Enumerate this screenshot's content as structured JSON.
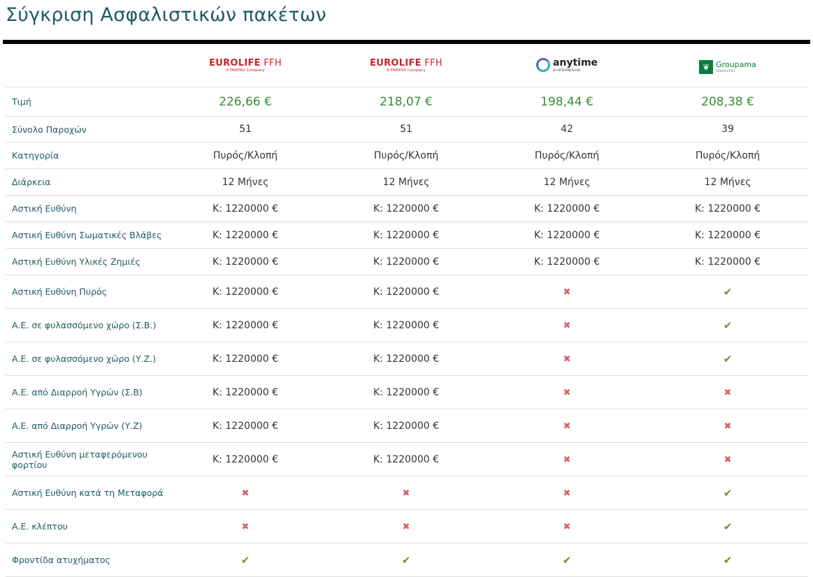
{
  "title": "Σύγκριση Ασφαλιστικών πακέτων",
  "colors": {
    "title": "#1f5b60",
    "price": "#3c8a3c",
    "yes": "#6a8f2e",
    "no": "#d86060"
  },
  "icons": {
    "yes": "checkmark-icon",
    "no": "cross-icon"
  },
  "symbols": {
    "yes": "✔",
    "no": "✖"
  },
  "providers": [
    {
      "name": "EUROLIFE FFH",
      "main_bold": "EUROLIFE",
      "main_thin": " FFH",
      "sub": "A FAIRFAX Company"
    },
    {
      "name": "EUROLIFE FFH",
      "main_bold": "EUROLIFE",
      "main_thin": " FFH",
      "sub": "A FAIRFAX Company"
    },
    {
      "name": "anytime",
      "main": "anytime",
      "sub": "BY INTERAMERICAN"
    },
    {
      "name": "Groupama",
      "main": "Groupama",
      "sub": "ΑΣΦΑΛΙΣΤΙΚΗ"
    }
  ],
  "rows": [
    {
      "label": "Τιμή",
      "values": [
        "226,66 €",
        "218,07 €",
        "198,44 €",
        "208,38 €"
      ]
    },
    {
      "label": "Σύνολο Παροχών",
      "values": [
        "51",
        "51",
        "42",
        "39"
      ]
    },
    {
      "label": "Κατηγορία",
      "values": [
        "Πυρός/Κλοπή",
        "Πυρός/Κλοπή",
        "Πυρός/Κλοπή",
        "Πυρός/Κλοπή"
      ]
    },
    {
      "label": "Διάρκεια",
      "values": [
        "12 Μήνες",
        "12 Μήνες",
        "12 Μήνες",
        "12 Μήνες"
      ]
    },
    {
      "label": "Αστική Ευθύνη",
      "values": [
        "Κ: 1220000 €",
        "Κ: 1220000 €",
        "Κ: 1220000 €",
        "Κ: 1220000 €"
      ]
    },
    {
      "label": "Αστική Ευθύνη Σωματικές Βλάβες",
      "values": [
        "Κ: 1220000 €",
        "Κ: 1220000 €",
        "Κ: 1220000 €",
        "Κ: 1220000 €"
      ]
    },
    {
      "label": "Αστική Ευθύνη Υλικές Ζημιές",
      "values": [
        "Κ: 1220000 €",
        "Κ: 1220000 €",
        "Κ: 1220000 €",
        "Κ: 1220000 €"
      ]
    },
    {
      "label": "Αστική Ευθύνη Πυρός",
      "values": [
        "Κ: 1220000 €",
        "Κ: 1220000 €",
        "no",
        "yes"
      ]
    },
    {
      "label": "Α.Ε. σε φυλασσόμενο χώρο (Σ.Β.)",
      "values": [
        "Κ: 1220000 €",
        "Κ: 1220000 €",
        "no",
        "yes"
      ]
    },
    {
      "label": "Α.Ε. σε φυλασσόμενο χώρο (Υ.Ζ.)",
      "values": [
        "Κ: 1220000 €",
        "Κ: 1220000 €",
        "no",
        "yes"
      ]
    },
    {
      "label": "Α.Ε. από Διαρροή Υγρών (Σ.Β)",
      "values": [
        "Κ: 1220000 €",
        "Κ: 1220000 €",
        "no",
        "no"
      ]
    },
    {
      "label": "Α.Ε. από Διαρροή Υγρών (Υ.Ζ)",
      "values": [
        "Κ: 1220000 €",
        "Κ: 1220000 €",
        "no",
        "no"
      ]
    },
    {
      "label": "Αστική Ευθύνη μεταφερόμενου φορτίου",
      "values": [
        "Κ: 1220000 €",
        "Κ: 1220000 €",
        "no",
        "no"
      ]
    },
    {
      "label": "Αστική Ευθύνη κατά τη Μεταφορά",
      "values": [
        "no",
        "no",
        "no",
        "yes"
      ]
    },
    {
      "label": "Α.Ε. κλέπτου",
      "values": [
        "no",
        "no",
        "no",
        "yes"
      ]
    },
    {
      "label": "Φροντίδα ατυχήματος",
      "values": [
        "yes",
        "yes",
        "yes",
        "yes"
      ]
    }
  ]
}
